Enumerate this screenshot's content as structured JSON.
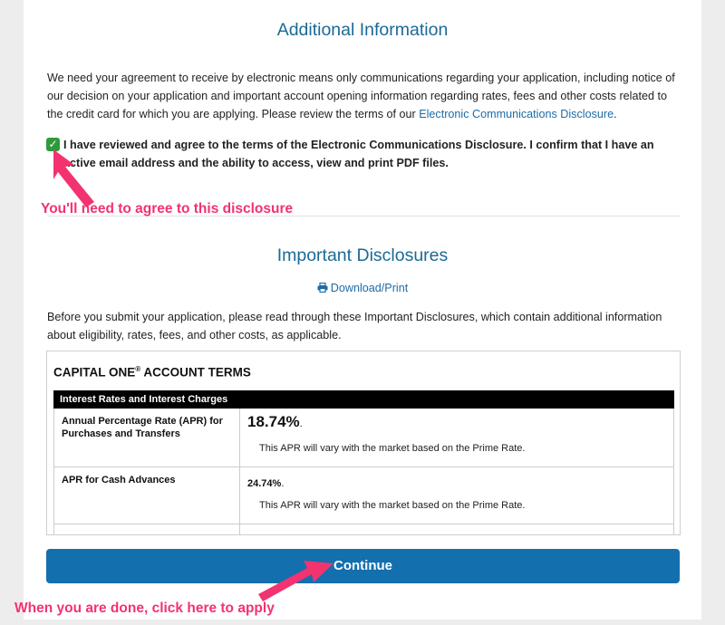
{
  "page": {
    "section1": {
      "heading": "Additional Information",
      "intro": "We need your agreement to receive by electronic means only communications regarding your application, including notice of our decision on your application and important account opening information regarding rates, fees and other costs related to the credit card for which you are applying. Please review the terms of our",
      "link_text": "Electronic Communications Disclosure",
      "link_suffix": ".",
      "agreement_text": "I have reviewed and agree to the terms of the Electronic Communications Disclosure. I confirm that I have an active email address and the ability to access, view and print PDF files.",
      "checkbox_checked": true
    },
    "section2": {
      "heading": "Important Disclosures",
      "download_label": "Download/Print",
      "intro": "Before you submit your application, please read through these Important Disclosures, which contain additional information about eligibility, rates, fees, and other costs, as applicable."
    },
    "terms": {
      "title": "CAPITAL ONE",
      "title_mark": "®",
      "title_suffix": " ACCOUNT TERMS",
      "table_header": "Interest Rates and Interest Charges",
      "rows": [
        {
          "label": "Annual Percentage Rate (APR) for Purchases and Transfers",
          "rate": "18.74%",
          "rate_suffix": ".",
          "note": "This APR will vary with the market based on the Prime Rate."
        },
        {
          "label": "APR for Cash Advances",
          "rate": "24.74%",
          "rate_suffix": ".",
          "note": "This APR will vary with the market based on the Prime Rate."
        }
      ]
    },
    "continue_label": "Continue"
  },
  "annotations": {
    "agree_note": "You'll need to agree to this disclosure",
    "apply_note": "When you are done, click here to apply",
    "color": "#f2336f"
  },
  "icons": {
    "checkbox": "checkmark-icon",
    "download": "printer-icon"
  },
  "colors": {
    "heading": "#1a6a96",
    "link": "#1d6ba8",
    "button": "#136fae",
    "checkbox": "#2f9a3b"
  }
}
